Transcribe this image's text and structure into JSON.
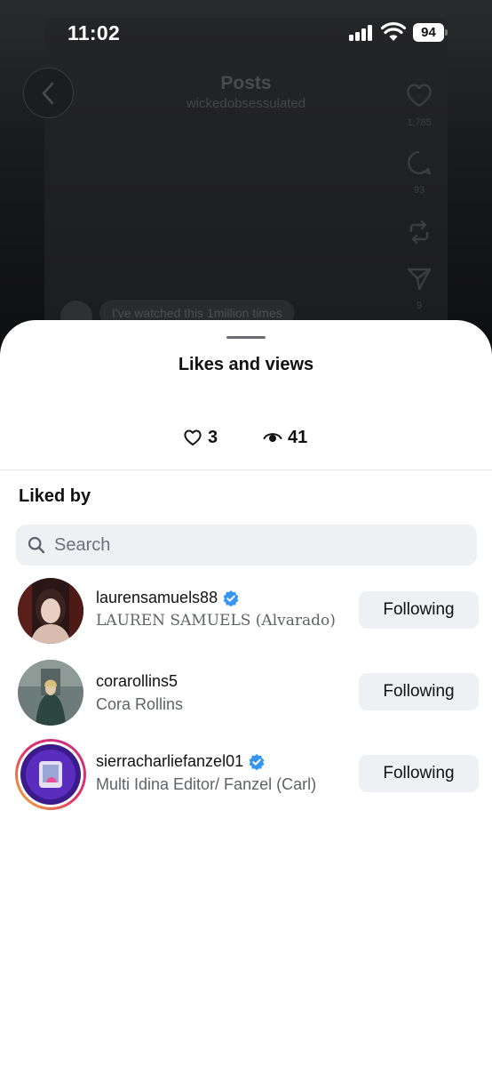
{
  "status_bar": {
    "time": "11:02",
    "battery": "94"
  },
  "background": {
    "title": "Posts",
    "subtitle": "wickedobsessulated",
    "like_count": "1,785",
    "comment_count": "93",
    "share_count": "9",
    "comment_preview": "I've watched this 1million times"
  },
  "sheet": {
    "title": "Likes and views",
    "likes": "3",
    "views": "41",
    "section_title": "Liked by",
    "search_placeholder": "Search"
  },
  "users": [
    {
      "username": "laurensamuels88",
      "verified": true,
      "fullname": "LAUREN SAMUELS (Alvarado)",
      "button": "Following"
    },
    {
      "username": "corarollins5",
      "verified": false,
      "fullname": "Cora Rollins",
      "button": "Following"
    },
    {
      "username": "sierracharliefanzel01",
      "verified": true,
      "fullname": "Multi Idina Editor/ Fanzel (Carl)",
      "button": "Following"
    }
  ],
  "colors": {
    "verified": "#3797f0",
    "button_bg": "#eff0f3",
    "secondary_text": "#5f6268"
  }
}
